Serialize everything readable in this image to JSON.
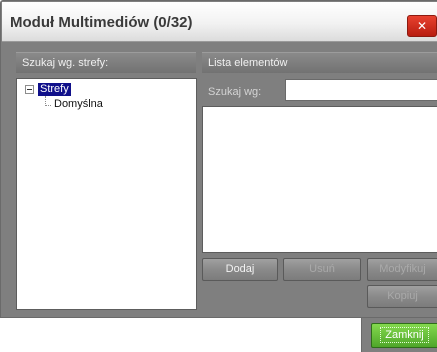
{
  "dialog": {
    "title": "Moduł Multimediów (0/32)",
    "close_label": "✕"
  },
  "left_panel": {
    "header": "Szukaj wg. strefy:",
    "tree": {
      "root": "Strefy",
      "children": [
        "Domyślna"
      ]
    }
  },
  "right_panel": {
    "header": "Lista elementów",
    "search_label": "Szukaj wg:",
    "search_value": "",
    "buttons": {
      "add": "Dodaj",
      "remove": "Usuń",
      "modify": "Modyfikuj",
      "copy": "Kopiuj"
    }
  },
  "footer": {
    "close": "Zamknij"
  },
  "colors": {
    "panel_bg": "#7f7f7f",
    "selection": "#10108a",
    "close_button": "#d02a1a",
    "footer_button": "#62b935"
  }
}
